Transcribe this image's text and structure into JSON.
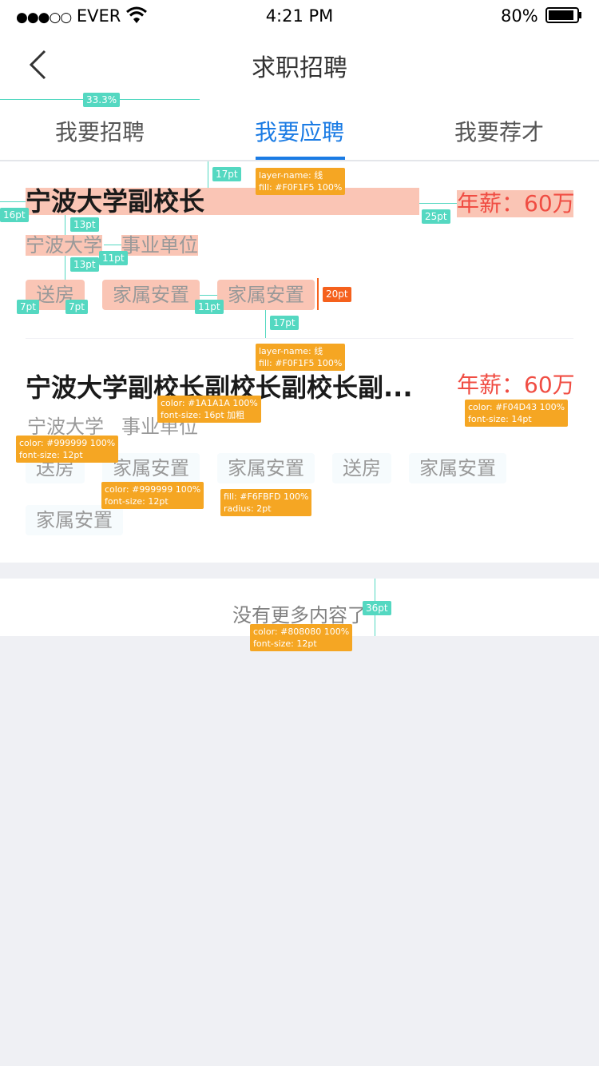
{
  "status_bar": {
    "signal": "●●●○○",
    "carrier": "EVER",
    "time": "4:21 PM",
    "battery": "80%"
  },
  "nav": {
    "title": "求职招聘"
  },
  "tabs": [
    {
      "label": "我要招聘"
    },
    {
      "label": "我要应聘"
    },
    {
      "label": "我要荐才"
    }
  ],
  "active_tab": 1,
  "jobs": [
    {
      "title": "宁波大学副校长",
      "salary": "年薪：60万",
      "org": "宁波大学",
      "org_type": "事业单位",
      "tags": [
        "送房",
        "家属安置",
        "家属安置"
      ]
    },
    {
      "title": "宁波大学副校长副校长副校长副...",
      "salary": "年薪：60万",
      "org": "宁波大学",
      "org_type": "事业单位",
      "tags": [
        "送房",
        "家属安置",
        "家属安置",
        "送房",
        "家属安置",
        "家属安置"
      ]
    }
  ],
  "footer": {
    "no_more": "没有更多内容了"
  },
  "annotations": {
    "tab_width": "33.3%",
    "line1": "layer-name: 线\nfill: #F0F1F5 100%",
    "line2": "layer-name: 线\nfill: #F0F1F5 100%",
    "title_style": "color: #1A1A1A 100%\nfont-size: 16pt 加粗",
    "salary_style": "color: #F04D43 100%\nfont-size: 14pt",
    "meta_style": "color: #999999 100%\nfont-size: 12pt",
    "tag_style": "color: #999999 100%\nfont-size: 12pt",
    "tag_fill": "fill: #F6FBFD 100%\nradius: 2pt",
    "footer_style": "color: #808080 100%\nfont-size: 12pt",
    "d_17pt_top": "17pt",
    "d_16pt": "16pt",
    "d_25pt": "25pt",
    "d_13pt_a": "13pt",
    "d_11pt_a": "11pt",
    "d_13pt_b": "13pt",
    "d_7pt_a": "7pt",
    "d_7pt_b": "7pt",
    "d_11pt_b": "11pt",
    "d_20pt": "20pt",
    "d_17pt_bottom": "17pt",
    "d_36pt": "36pt"
  },
  "colors": {
    "accent": "#1A7BE4",
    "salary": "#F04D43",
    "title": "#1A1A1A",
    "meta": "#999999",
    "tag_bg": "#F6FBFD",
    "divider": "#F0F1F5",
    "footer_text": "#808080",
    "page_bg": "#EFF0F4"
  }
}
